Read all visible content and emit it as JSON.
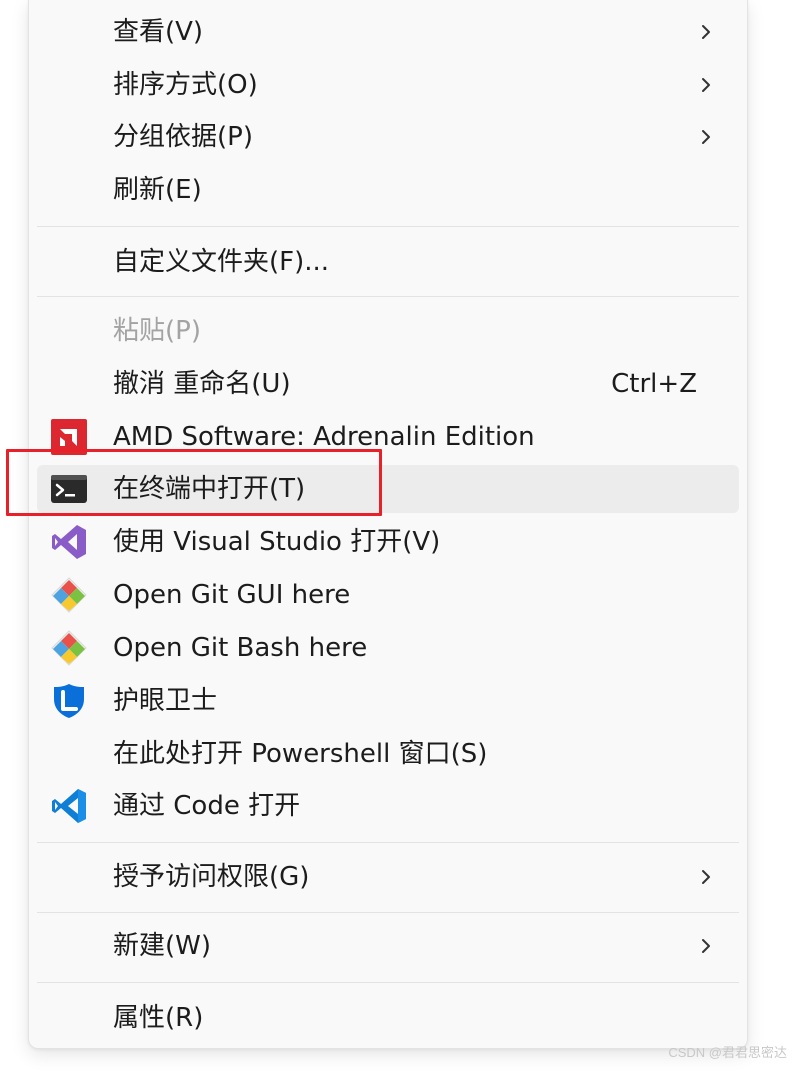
{
  "menu": {
    "items": [
      {
        "label": "查看(V)",
        "has_submenu": true
      },
      {
        "label": "排序方式(O)",
        "has_submenu": true
      },
      {
        "label": "分组依据(P)",
        "has_submenu": true
      },
      {
        "label": "刷新(E)"
      },
      {
        "label": "自定义文件夹(F)..."
      },
      {
        "label": "粘贴(P)",
        "disabled": true
      },
      {
        "label": "撤消 重命名(U)",
        "shortcut": "Ctrl+Z"
      },
      {
        "label": "AMD Software: Adrenalin Edition",
        "icon": "amd-icon"
      },
      {
        "label": "在终端中打开(T)",
        "icon": "terminal-icon",
        "hovered": true
      },
      {
        "label": "使用 Visual Studio 打开(V)",
        "icon": "visual-studio-icon"
      },
      {
        "label": "Open Git GUI here",
        "icon": "git-gui-icon"
      },
      {
        "label": "Open Git Bash here",
        "icon": "git-bash-icon"
      },
      {
        "label": "护眼卫士",
        "icon": "eye-protection-icon"
      },
      {
        "label": "在此处打开 Powershell 窗口(S)"
      },
      {
        "label": "通过 Code 打开",
        "icon": "vscode-icon"
      },
      {
        "label": "授予访问权限(G)",
        "has_submenu": true
      },
      {
        "label": "新建(W)",
        "has_submenu": true
      },
      {
        "label": "属性(R)"
      }
    ]
  },
  "colors": {
    "highlight_box": "#e8202a",
    "amd_red": "#dd2730",
    "vs_purple": "#8a5cc8",
    "vscode_blue": "#0f7fd6"
  },
  "watermark": "CSDN @君君思密达"
}
